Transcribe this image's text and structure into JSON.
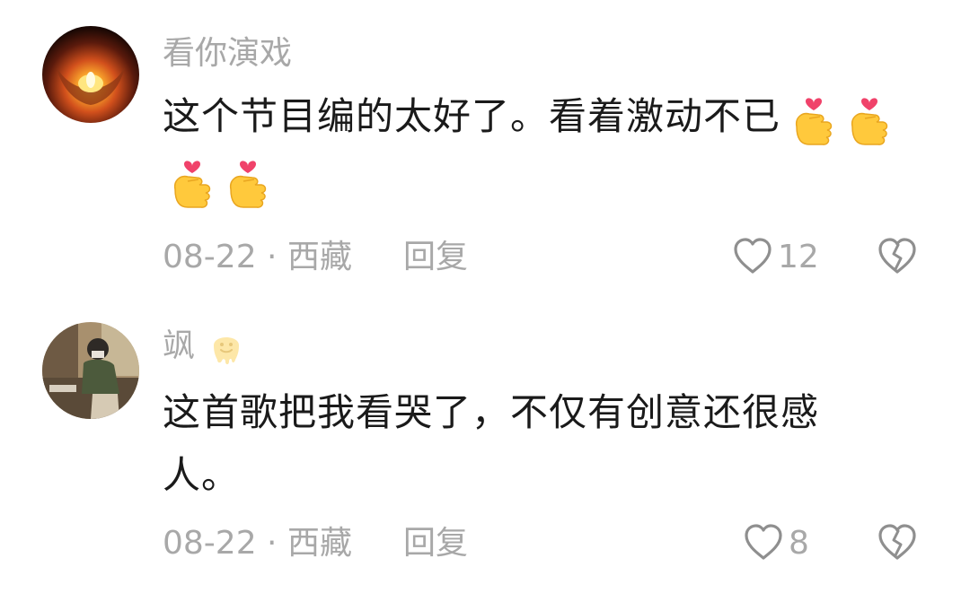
{
  "comments": [
    {
      "username": "看你演戏",
      "text_line1": "这个节目编的太好了。看着激动不已",
      "emoji_icons": [
        "finger-heart-icon",
        "finger-heart-icon",
        "finger-heart-icon",
        "finger-heart-icon"
      ],
      "date_location": "08-22 · 西藏",
      "reply_label": "回复",
      "like_count": "12"
    },
    {
      "username": "飒",
      "username_emoji": "melting-face-icon",
      "text_line1": "这首歌把我看哭了，不仅有创意还很感",
      "text_line2": "人。",
      "date_location": "08-22 · 西藏",
      "reply_label": "回复",
      "like_count": "8"
    }
  ],
  "colors": {
    "text": "#1a1a1a",
    "secondary": "#a8a8a8",
    "background": "#ffffff",
    "emoji_yellow": "#ffc93c",
    "emoji_heart": "#f0426a"
  }
}
